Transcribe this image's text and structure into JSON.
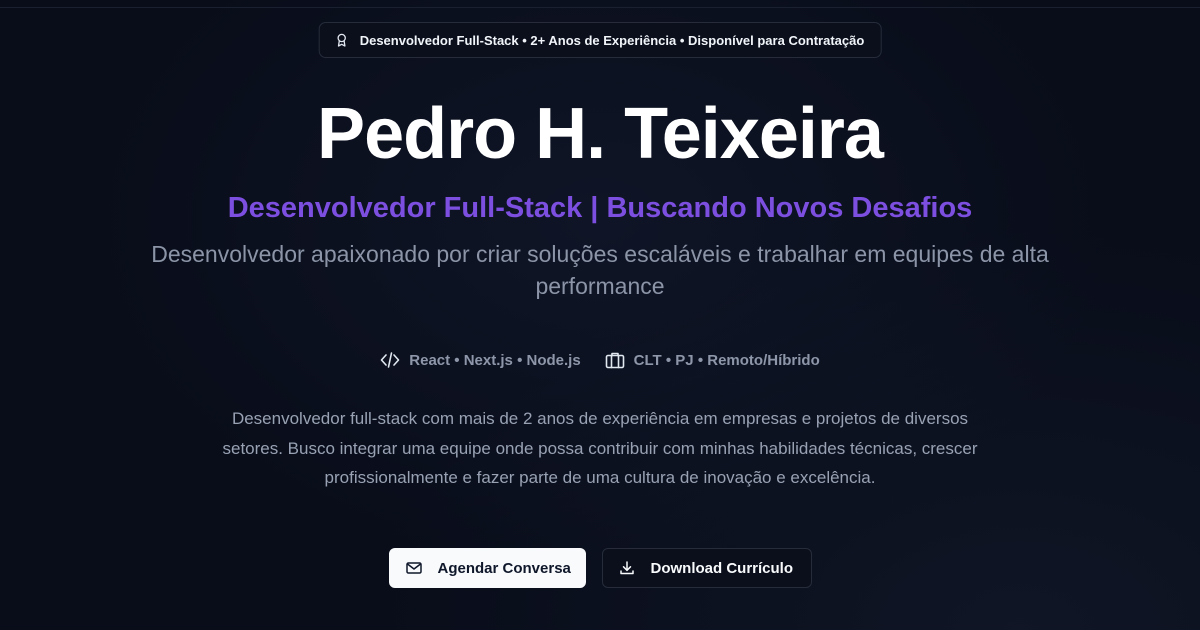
{
  "badge": {
    "icon": "award-icon",
    "text": "Desenvolvedor Full-Stack • 2+ Anos de Experiência • Disponível para Contratação"
  },
  "hero": {
    "name": "Pedro H. Teixeira",
    "role": "Desenvolvedor Full-Stack | Buscando Novos Desafios",
    "tagline": "Desenvolvedor apaixonado por criar soluções escaláveis e trabalhar em equipes de alta performance"
  },
  "meta": {
    "stack": {
      "icon": "code-icon",
      "text": "React • Next.js • Node.js"
    },
    "contract": {
      "icon": "briefcase-icon",
      "text": "CLT • PJ • Remoto/Híbrido"
    }
  },
  "about": "Desenvolvedor full-stack com mais de 2 anos de experiência em empresas e projetos de diversos setores. Busco integrar uma equipe onde possa contribuir com minhas habilidades técnicas, crescer profissionalmente e fazer parte de uma cultura de inovação e excelência.",
  "actions": {
    "schedule": {
      "label": "Agendar Conversa",
      "icon": "mail-icon"
    },
    "download": {
      "label": "Download Currículo",
      "icon": "download-icon"
    }
  },
  "colors": {
    "background": "#090d1a",
    "accent": "#7c4fe0",
    "text_primary": "#ffffff",
    "text_muted": "#8b95a7",
    "border": "#262c3a"
  }
}
